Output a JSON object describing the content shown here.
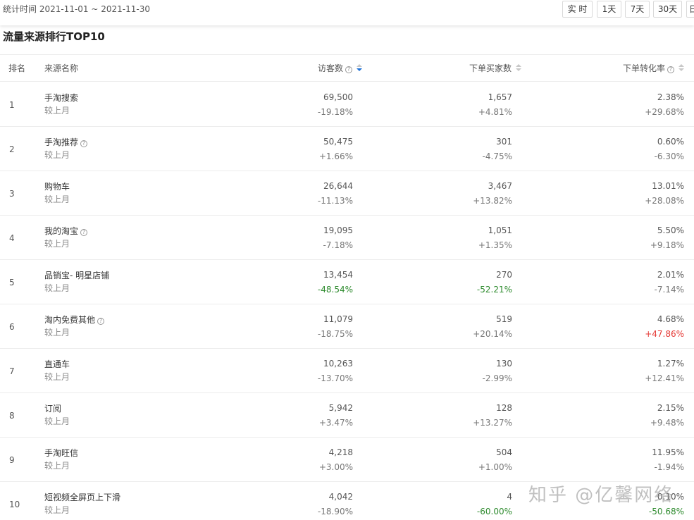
{
  "header": {
    "date_range": "统计时间 2021-11-01 ~ 2021-11-30",
    "buttons": {
      "realtime": "实 时",
      "d1": "1天",
      "d7": "7天",
      "d30": "30天",
      "more": "日"
    }
  },
  "section_title": "流量来源排行TOP10",
  "table": {
    "columns": {
      "rank": "排名",
      "name": "来源名称",
      "visitors": "访客数",
      "buyers": "下单买家数",
      "rate": "下单转化率"
    },
    "rows": [
      {
        "rank": "1",
        "name": "手淘搜索",
        "sub": "较上月",
        "visitors": "69,500",
        "visitors_change": "-19.18%",
        "buyers": "1,657",
        "buyers_change": "+4.81%",
        "rate": "2.38%",
        "rate_change": "+29.68%"
      },
      {
        "rank": "2",
        "name": "手淘推荐",
        "sub": "较上月",
        "visitors": "50,475",
        "visitors_change": "+1.66%",
        "buyers": "301",
        "buyers_change": "-4.75%",
        "rate": "0.60%",
        "rate_change": "-6.30%"
      },
      {
        "rank": "3",
        "name": "购物车",
        "sub": "较上月",
        "visitors": "26,644",
        "visitors_change": "-11.13%",
        "buyers": "3,467",
        "buyers_change": "+13.82%",
        "rate": "13.01%",
        "rate_change": "+28.08%"
      },
      {
        "rank": "4",
        "name": "我的淘宝",
        "sub": "较上月",
        "visitors": "19,095",
        "visitors_change": "-7.18%",
        "buyers": "1,051",
        "buyers_change": "+1.35%",
        "rate": "5.50%",
        "rate_change": "+9.18%"
      },
      {
        "rank": "5",
        "name": "品销宝- 明星店铺",
        "sub": "较上月",
        "visitors": "13,454",
        "visitors_change": "-48.54%",
        "buyers": "270",
        "buyers_change": "-52.21%",
        "rate": "2.01%",
        "rate_change": "-7.14%"
      },
      {
        "rank": "6",
        "name": "淘内免费其他",
        "sub": "较上月",
        "visitors": "11,079",
        "visitors_change": "-18.75%",
        "buyers": "519",
        "buyers_change": "+20.14%",
        "rate": "4.68%",
        "rate_change": "+47.86%"
      },
      {
        "rank": "7",
        "name": "直通车",
        "sub": "较上月",
        "visitors": "10,263",
        "visitors_change": "-13.70%",
        "buyers": "130",
        "buyers_change": "-2.99%",
        "rate": "1.27%",
        "rate_change": "+12.41%"
      },
      {
        "rank": "8",
        "name": "订阅",
        "sub": "较上月",
        "visitors": "5,942",
        "visitors_change": "+3.47%",
        "buyers": "128",
        "buyers_change": "+13.27%",
        "rate": "2.15%",
        "rate_change": "+9.48%"
      },
      {
        "rank": "9",
        "name": "手淘旺信",
        "sub": "较上月",
        "visitors": "4,218",
        "visitors_change": "+3.00%",
        "buyers": "504",
        "buyers_change": "+1.00%",
        "rate": "11.95%",
        "rate_change": "-1.94%"
      },
      {
        "rank": "10",
        "name": "短视频全屏页上下滑",
        "sub": "较上月",
        "visitors": "4,042",
        "visitors_change": "-18.90%",
        "buyers": "4",
        "buyers_change": "-60.00%",
        "rate": "0.10%",
        "rate_change": "-50.68%"
      }
    ]
  },
  "watermark": "知乎 @亿馨网络",
  "colors": {
    "down_highlight": "#2e8b2e",
    "up_highlight": "#e53935",
    "sort_active": "#1e72d8"
  }
}
